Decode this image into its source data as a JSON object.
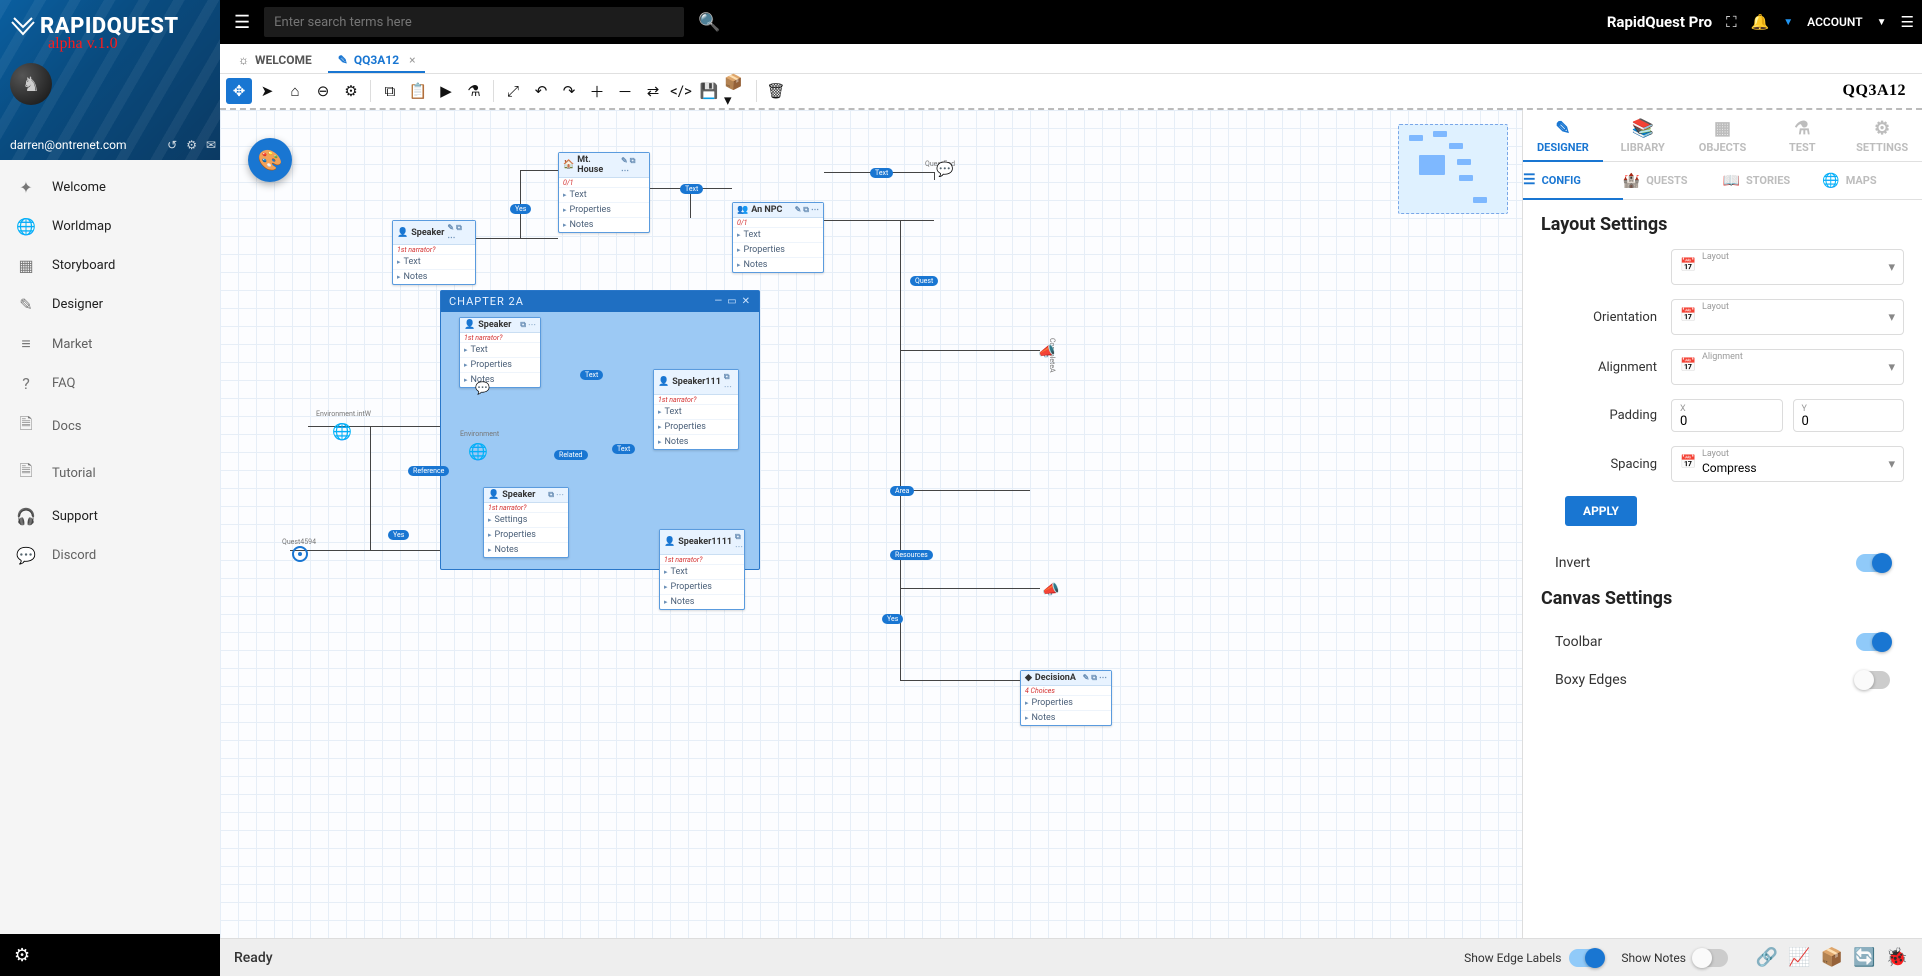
{
  "brand": {
    "name": "RAPIDQUEST",
    "subtitle": "alpha v.1.0"
  },
  "user": {
    "email": "darren@ontrenet.com"
  },
  "nav": [
    {
      "icon": "✦",
      "label": "Welcome",
      "active": true
    },
    {
      "icon": "🌐",
      "label": "Worldmap",
      "active": true
    },
    {
      "icon": "▦",
      "label": "Storyboard",
      "active": true
    },
    {
      "icon": "✎",
      "label": "Designer",
      "active": true
    },
    {
      "icon": "≡",
      "label": "Market",
      "active": false
    },
    {
      "icon": "?",
      "label": "FAQ",
      "active": false
    },
    {
      "icon": "🗎",
      "label": "Docs",
      "active": false
    },
    {
      "icon": "🗎",
      "label": "Tutorial",
      "active": false
    },
    {
      "icon": "🎧",
      "label": "Support",
      "active": true
    },
    {
      "icon": "💬",
      "label": "Discord",
      "active": false
    }
  ],
  "topbar": {
    "search_placeholder": "Enter search terms here",
    "product": "RapidQuest Pro",
    "account_label": "ACCOUNT"
  },
  "filetabs": [
    {
      "label": "WELCOME",
      "active": false,
      "icon": "☼"
    },
    {
      "label": "QQ3A12",
      "active": true,
      "icon": "✎",
      "closable": true
    }
  ],
  "doc_title": "QQ3A12",
  "canvas": {
    "chapter_label": "CHAPTER 2A",
    "nodes_outer": [
      {
        "title": "Speaker",
        "sub": "1st narrator?",
        "rows": [
          "Text",
          "Notes"
        ]
      },
      {
        "title": "Mt. House",
        "sub": "0/1",
        "rows": [
          "Text",
          "Properties",
          "Notes"
        ]
      },
      {
        "title": "An NPC",
        "sub": "0/1",
        "rows": [
          "Text",
          "Properties",
          "Notes"
        ]
      },
      {
        "title": "DecisionA",
        "sub": "4 Choices",
        "rows": [
          "Properties",
          "Notes"
        ]
      }
    ],
    "nodes_inner": [
      {
        "title": "Speaker",
        "sub": "1st narrator?",
        "rows": [
          "Text",
          "Properties",
          "Notes"
        ]
      },
      {
        "title": "Speaker111",
        "sub": "1st narrator?",
        "rows": [
          "Text",
          "Properties",
          "Notes"
        ]
      },
      {
        "title": "Speaker",
        "sub": "1st narrator?",
        "rows": [
          "Settings",
          "Properties",
          "Notes"
        ]
      },
      {
        "title": "Speaker1111",
        "sub": "1st narrator?",
        "rows": [
          "Text",
          "Properties",
          "Notes"
        ]
      }
    ],
    "edge_labels": [
      "Yes",
      "Text",
      "Text",
      "Text",
      "Related",
      "Reference",
      "Text",
      "Resources",
      "Quest",
      "Yes",
      "Resource",
      "Area",
      "Yes"
    ],
    "small_labels": [
      "QuestEnd",
      "CompleteA",
      "Environment.intW",
      "Environment",
      "Quest4594"
    ]
  },
  "rpanel": {
    "tabs1": [
      "DESIGNER",
      "LIBRARY",
      "OBJECTS",
      "TEST",
      "SETTINGS"
    ],
    "tabs2": [
      "CONFIG",
      "QUESTS",
      "STORIES",
      "MAPS"
    ],
    "layout_settings_header": "Layout Settings",
    "canvas_settings_header": "Canvas Settings",
    "labels": {
      "layout": "Layout",
      "orientation": "Orientation",
      "alignment": "Alignment",
      "padding": "Padding",
      "spacing": "Spacing",
      "x": "X",
      "y": "Y",
      "apply": "APPLY",
      "invert": "Invert",
      "toolbar": "Toolbar",
      "boxy": "Boxy Edges",
      "spacing_value": "Compress",
      "alignment_hint": "Alignment",
      "layout_hint": "Layout"
    },
    "values": {
      "padding_x": "0",
      "padding_y": "0"
    },
    "switches": {
      "invert": true,
      "toolbar": true,
      "boxy": false
    }
  },
  "statusbar": {
    "status": "Ready",
    "show_edge_labels": "Show Edge Labels",
    "show_notes": "Show Notes"
  }
}
